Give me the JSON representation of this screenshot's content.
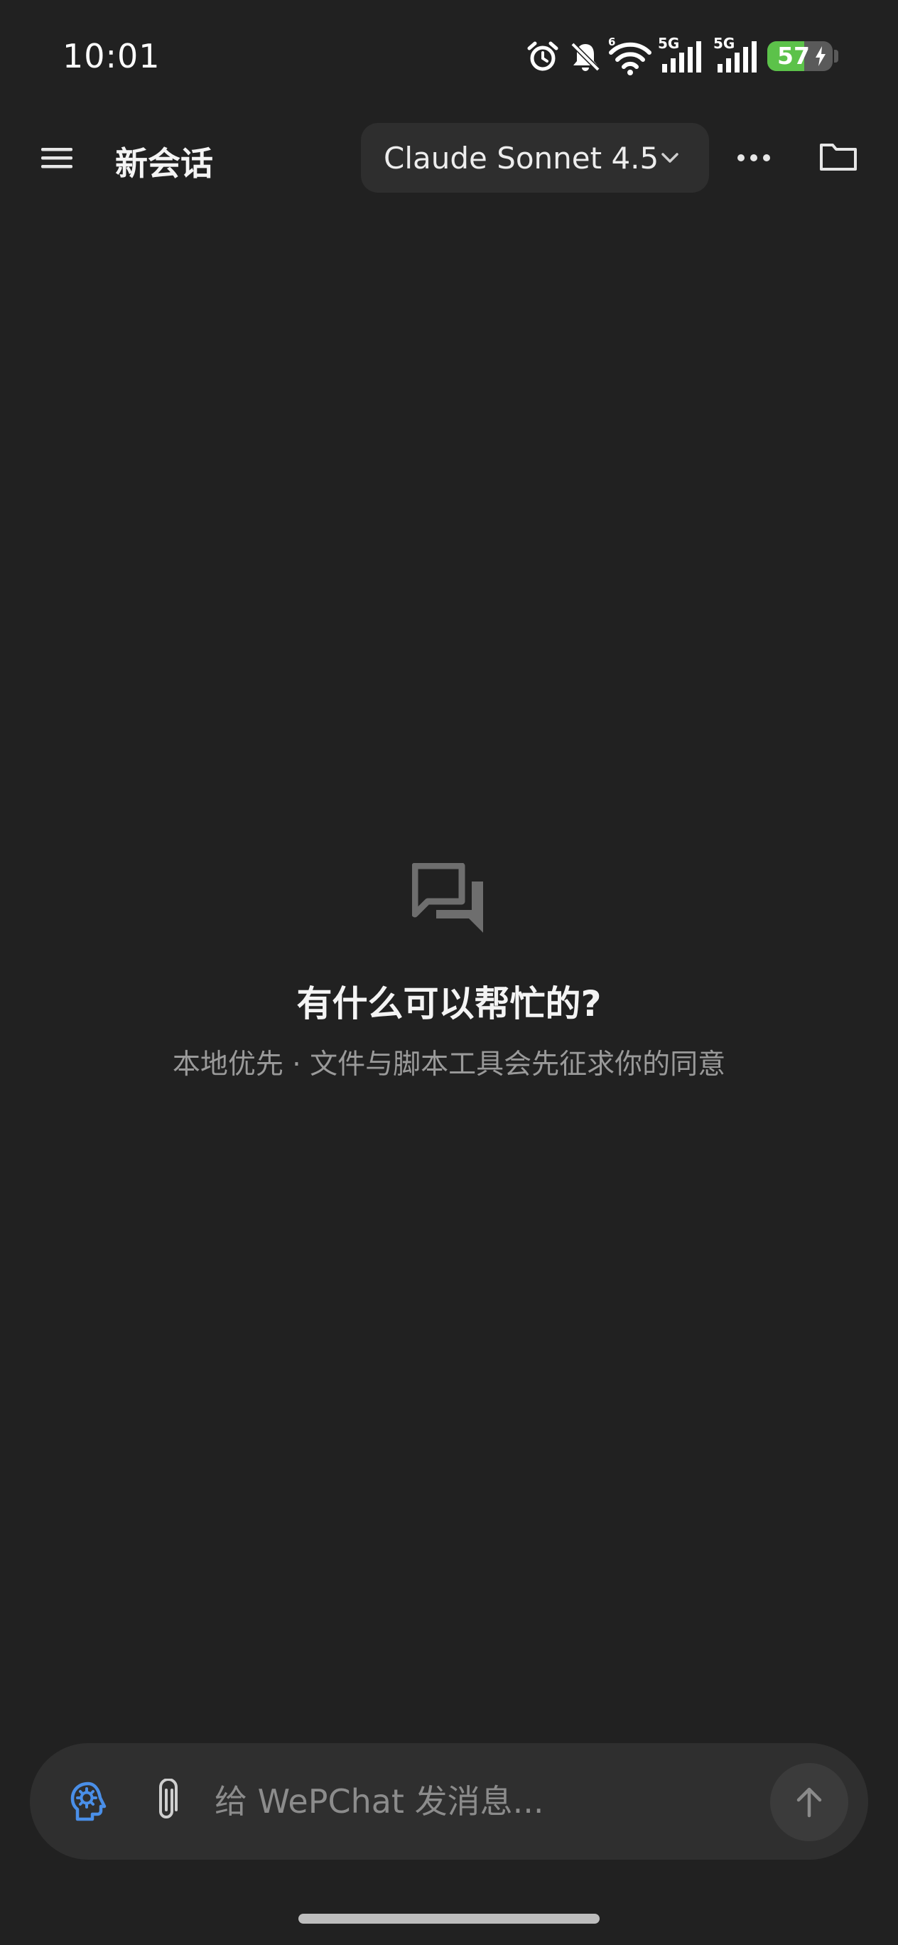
{
  "status_bar": {
    "time": "10:01",
    "network_1": "5G",
    "network_2": "5G",
    "wifi_badge": "6",
    "battery_level": 57,
    "battery_text": "57",
    "battery_color": "#5cc24a",
    "icons": [
      "alarm-icon",
      "bell-off-icon",
      "wifi-icon",
      "signal-icon",
      "signal-icon",
      "battery-icon",
      "charging-bolt-icon"
    ]
  },
  "header": {
    "title": "新会话",
    "model_label": "Claude Sonnet 4.5",
    "icons": [
      "hamburger-menu-icon",
      "chevron-down-icon",
      "more-horizontal-icon",
      "folder-icon"
    ]
  },
  "empty_state": {
    "icon": "chat-bubbles-icon",
    "title": "有什么可以帮忙的?",
    "subtitle": "本地优先 · 文件与脚本工具会先征求你的同意"
  },
  "composer": {
    "value": "",
    "placeholder": "给 WePChat 发消息...",
    "accent_color": "#4a8fe8",
    "icons": [
      "brain-gear-icon",
      "paperclip-icon",
      "arrow-up-icon"
    ]
  }
}
